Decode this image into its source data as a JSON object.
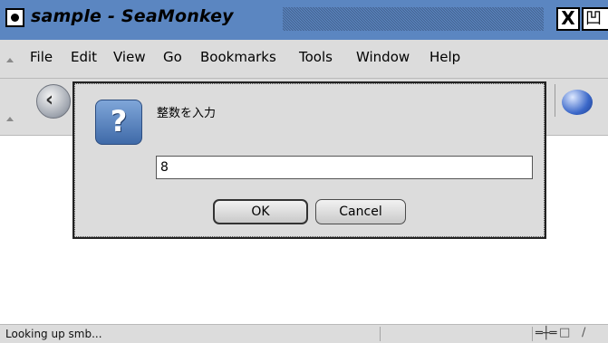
{
  "window": {
    "title": "sample - SeaMonkey",
    "close_glyph": "X",
    "maximize_glyph": "凹"
  },
  "menubar": {
    "items": [
      {
        "label": "File"
      },
      {
        "label": "Edit"
      },
      {
        "label": "View"
      },
      {
        "label": "Go"
      },
      {
        "label": "Bookmarks"
      },
      {
        "label": "Tools"
      },
      {
        "label": "Window"
      },
      {
        "label": "Help"
      }
    ]
  },
  "toolbar": {
    "back_icon": "back-arrow-icon",
    "throbber_icon": "seamonkey-throbber-icon"
  },
  "dialog": {
    "prompt": "整数を入力",
    "input_value": "8",
    "ok_label": "OK",
    "cancel_label": "Cancel",
    "icon": "question-icon"
  },
  "statusbar": {
    "text": "Looking up smb..."
  },
  "colors": {
    "titlebar": "#5b86c1",
    "chrome": "#dcdcdc",
    "dialog_bg": "#dcdcdc"
  }
}
